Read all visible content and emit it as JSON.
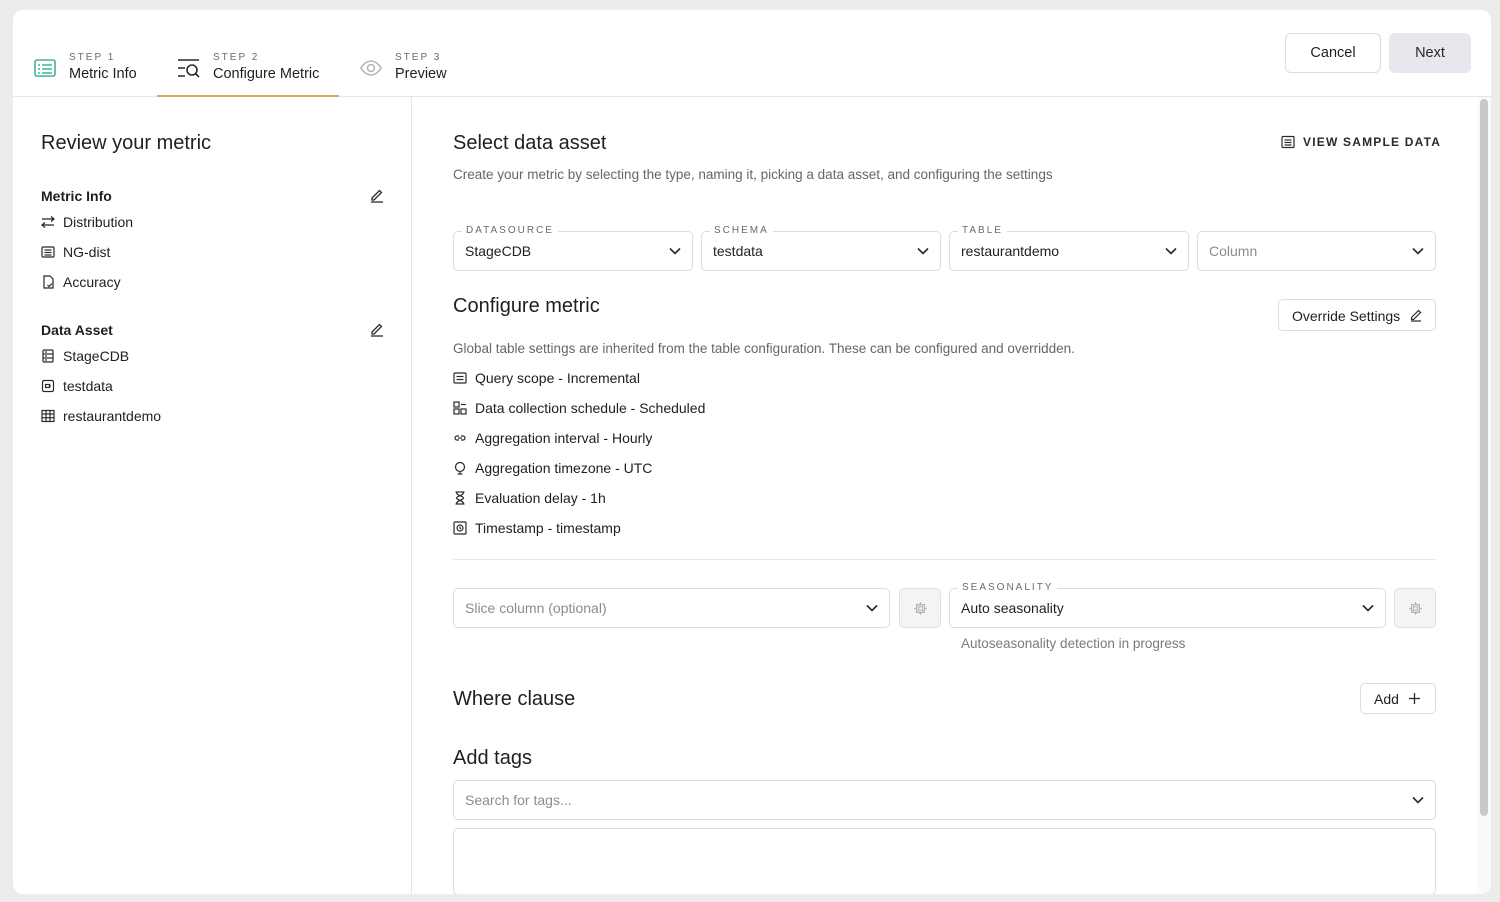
{
  "steps": [
    {
      "kicker": "STEP 1",
      "title": "Metric Info",
      "icon": "list-icon"
    },
    {
      "kicker": "STEP 2",
      "title": "Configure Metric",
      "icon": "search-filter-icon"
    },
    {
      "kicker": "STEP 3",
      "title": "Preview",
      "icon": "eye-icon"
    }
  ],
  "header": {
    "cancel_label": "Cancel",
    "next_label": "Next"
  },
  "sidebar": {
    "title": "Review your metric",
    "metric_info": {
      "heading": "Metric Info",
      "items": [
        {
          "label": "Distribution",
          "icon": "distribution-icon"
        },
        {
          "label": "NG-dist",
          "icon": "list-icon"
        },
        {
          "label": "Accuracy",
          "icon": "document-check-icon"
        }
      ]
    },
    "data_asset": {
      "heading": "Data Asset",
      "items": [
        {
          "label": "StageCDB",
          "icon": "database-icon"
        },
        {
          "label": "testdata",
          "icon": "schema-icon"
        },
        {
          "label": "restaurantdemo",
          "icon": "table-icon"
        }
      ]
    }
  },
  "main": {
    "select_title": "Select data asset",
    "view_sample_label": "VIEW SAMPLE DATA",
    "select_desc": "Create your metric by selecting the type, naming it, picking a data asset, and configuring the settings",
    "datasource": {
      "label": "DATASOURCE",
      "value": "StageCDB"
    },
    "schema": {
      "label": "SCHEMA",
      "value": "testdata"
    },
    "table": {
      "label": "TABLE",
      "value": "restaurantdemo"
    },
    "column": {
      "placeholder": "Column"
    },
    "configure_title": "Configure metric",
    "override_label": "Override Settings",
    "configure_desc": "Global table settings are inherited from the table configuration. These can be configured and overridden.",
    "settings": [
      {
        "label": "Query scope - Incremental",
        "icon": "scope-icon"
      },
      {
        "label": "Data collection schedule - Scheduled",
        "icon": "schedule-icon"
      },
      {
        "label": "Aggregation interval - Hourly",
        "icon": "link-icon"
      },
      {
        "label": "Aggregation timezone - UTC",
        "icon": "globe-icon"
      },
      {
        "label": "Evaluation delay - 1h",
        "icon": "hourglass-icon"
      },
      {
        "label": "Timestamp - timestamp",
        "icon": "timestamp-icon"
      }
    ],
    "slice": {
      "placeholder": "Slice column (optional)"
    },
    "seasonality": {
      "label": "SEASONALITY",
      "value": "Auto seasonality",
      "hint": "Autoseasonality detection in progress"
    },
    "where_title": "Where clause",
    "add_label": "Add",
    "tags_title": "Add tags",
    "tags_placeholder": "Search for tags..."
  }
}
